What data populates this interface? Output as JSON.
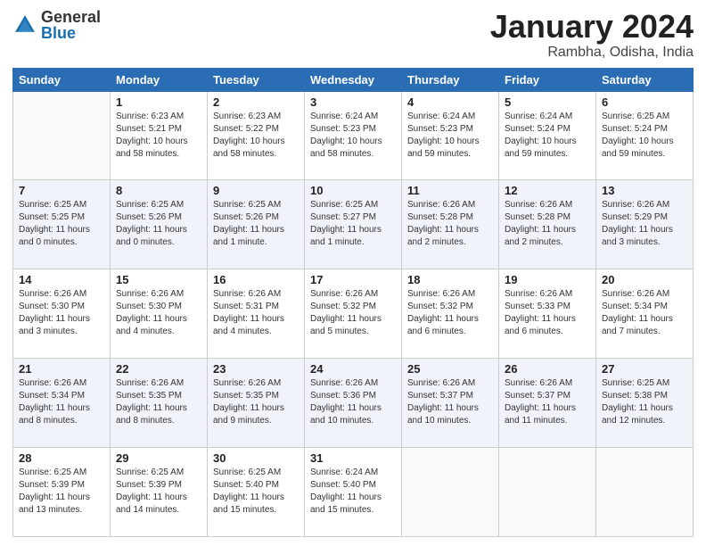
{
  "logo": {
    "general": "General",
    "blue": "Blue"
  },
  "header": {
    "month": "January 2024",
    "location": "Rambha, Odisha, India"
  },
  "days_of_week": [
    "Sunday",
    "Monday",
    "Tuesday",
    "Wednesday",
    "Thursday",
    "Friday",
    "Saturday"
  ],
  "weeks": [
    [
      {
        "day": "",
        "info": ""
      },
      {
        "day": "1",
        "info": "Sunrise: 6:23 AM\nSunset: 5:21 PM\nDaylight: 10 hours\nand 58 minutes."
      },
      {
        "day": "2",
        "info": "Sunrise: 6:23 AM\nSunset: 5:22 PM\nDaylight: 10 hours\nand 58 minutes."
      },
      {
        "day": "3",
        "info": "Sunrise: 6:24 AM\nSunset: 5:23 PM\nDaylight: 10 hours\nand 58 minutes."
      },
      {
        "day": "4",
        "info": "Sunrise: 6:24 AM\nSunset: 5:23 PM\nDaylight: 10 hours\nand 59 minutes."
      },
      {
        "day": "5",
        "info": "Sunrise: 6:24 AM\nSunset: 5:24 PM\nDaylight: 10 hours\nand 59 minutes."
      },
      {
        "day": "6",
        "info": "Sunrise: 6:25 AM\nSunset: 5:24 PM\nDaylight: 10 hours\nand 59 minutes."
      }
    ],
    [
      {
        "day": "7",
        "info": "Sunrise: 6:25 AM\nSunset: 5:25 PM\nDaylight: 11 hours\nand 0 minutes."
      },
      {
        "day": "8",
        "info": "Sunrise: 6:25 AM\nSunset: 5:26 PM\nDaylight: 11 hours\nand 0 minutes."
      },
      {
        "day": "9",
        "info": "Sunrise: 6:25 AM\nSunset: 5:26 PM\nDaylight: 11 hours\nand 1 minute."
      },
      {
        "day": "10",
        "info": "Sunrise: 6:25 AM\nSunset: 5:27 PM\nDaylight: 11 hours\nand 1 minute."
      },
      {
        "day": "11",
        "info": "Sunrise: 6:26 AM\nSunset: 5:28 PM\nDaylight: 11 hours\nand 2 minutes."
      },
      {
        "day": "12",
        "info": "Sunrise: 6:26 AM\nSunset: 5:28 PM\nDaylight: 11 hours\nand 2 minutes."
      },
      {
        "day": "13",
        "info": "Sunrise: 6:26 AM\nSunset: 5:29 PM\nDaylight: 11 hours\nand 3 minutes."
      }
    ],
    [
      {
        "day": "14",
        "info": "Sunrise: 6:26 AM\nSunset: 5:30 PM\nDaylight: 11 hours\nand 3 minutes."
      },
      {
        "day": "15",
        "info": "Sunrise: 6:26 AM\nSunset: 5:30 PM\nDaylight: 11 hours\nand 4 minutes."
      },
      {
        "day": "16",
        "info": "Sunrise: 6:26 AM\nSunset: 5:31 PM\nDaylight: 11 hours\nand 4 minutes."
      },
      {
        "day": "17",
        "info": "Sunrise: 6:26 AM\nSunset: 5:32 PM\nDaylight: 11 hours\nand 5 minutes."
      },
      {
        "day": "18",
        "info": "Sunrise: 6:26 AM\nSunset: 5:32 PM\nDaylight: 11 hours\nand 6 minutes."
      },
      {
        "day": "19",
        "info": "Sunrise: 6:26 AM\nSunset: 5:33 PM\nDaylight: 11 hours\nand 6 minutes."
      },
      {
        "day": "20",
        "info": "Sunrise: 6:26 AM\nSunset: 5:34 PM\nDaylight: 11 hours\nand 7 minutes."
      }
    ],
    [
      {
        "day": "21",
        "info": "Sunrise: 6:26 AM\nSunset: 5:34 PM\nDaylight: 11 hours\nand 8 minutes."
      },
      {
        "day": "22",
        "info": "Sunrise: 6:26 AM\nSunset: 5:35 PM\nDaylight: 11 hours\nand 8 minutes."
      },
      {
        "day": "23",
        "info": "Sunrise: 6:26 AM\nSunset: 5:35 PM\nDaylight: 11 hours\nand 9 minutes."
      },
      {
        "day": "24",
        "info": "Sunrise: 6:26 AM\nSunset: 5:36 PM\nDaylight: 11 hours\nand 10 minutes."
      },
      {
        "day": "25",
        "info": "Sunrise: 6:26 AM\nSunset: 5:37 PM\nDaylight: 11 hours\nand 10 minutes."
      },
      {
        "day": "26",
        "info": "Sunrise: 6:26 AM\nSunset: 5:37 PM\nDaylight: 11 hours\nand 11 minutes."
      },
      {
        "day": "27",
        "info": "Sunrise: 6:25 AM\nSunset: 5:38 PM\nDaylight: 11 hours\nand 12 minutes."
      }
    ],
    [
      {
        "day": "28",
        "info": "Sunrise: 6:25 AM\nSunset: 5:39 PM\nDaylight: 11 hours\nand 13 minutes."
      },
      {
        "day": "29",
        "info": "Sunrise: 6:25 AM\nSunset: 5:39 PM\nDaylight: 11 hours\nand 14 minutes."
      },
      {
        "day": "30",
        "info": "Sunrise: 6:25 AM\nSunset: 5:40 PM\nDaylight: 11 hours\nand 15 minutes."
      },
      {
        "day": "31",
        "info": "Sunrise: 6:24 AM\nSunset: 5:40 PM\nDaylight: 11 hours\nand 15 minutes."
      },
      {
        "day": "",
        "info": ""
      },
      {
        "day": "",
        "info": ""
      },
      {
        "day": "",
        "info": ""
      }
    ]
  ]
}
